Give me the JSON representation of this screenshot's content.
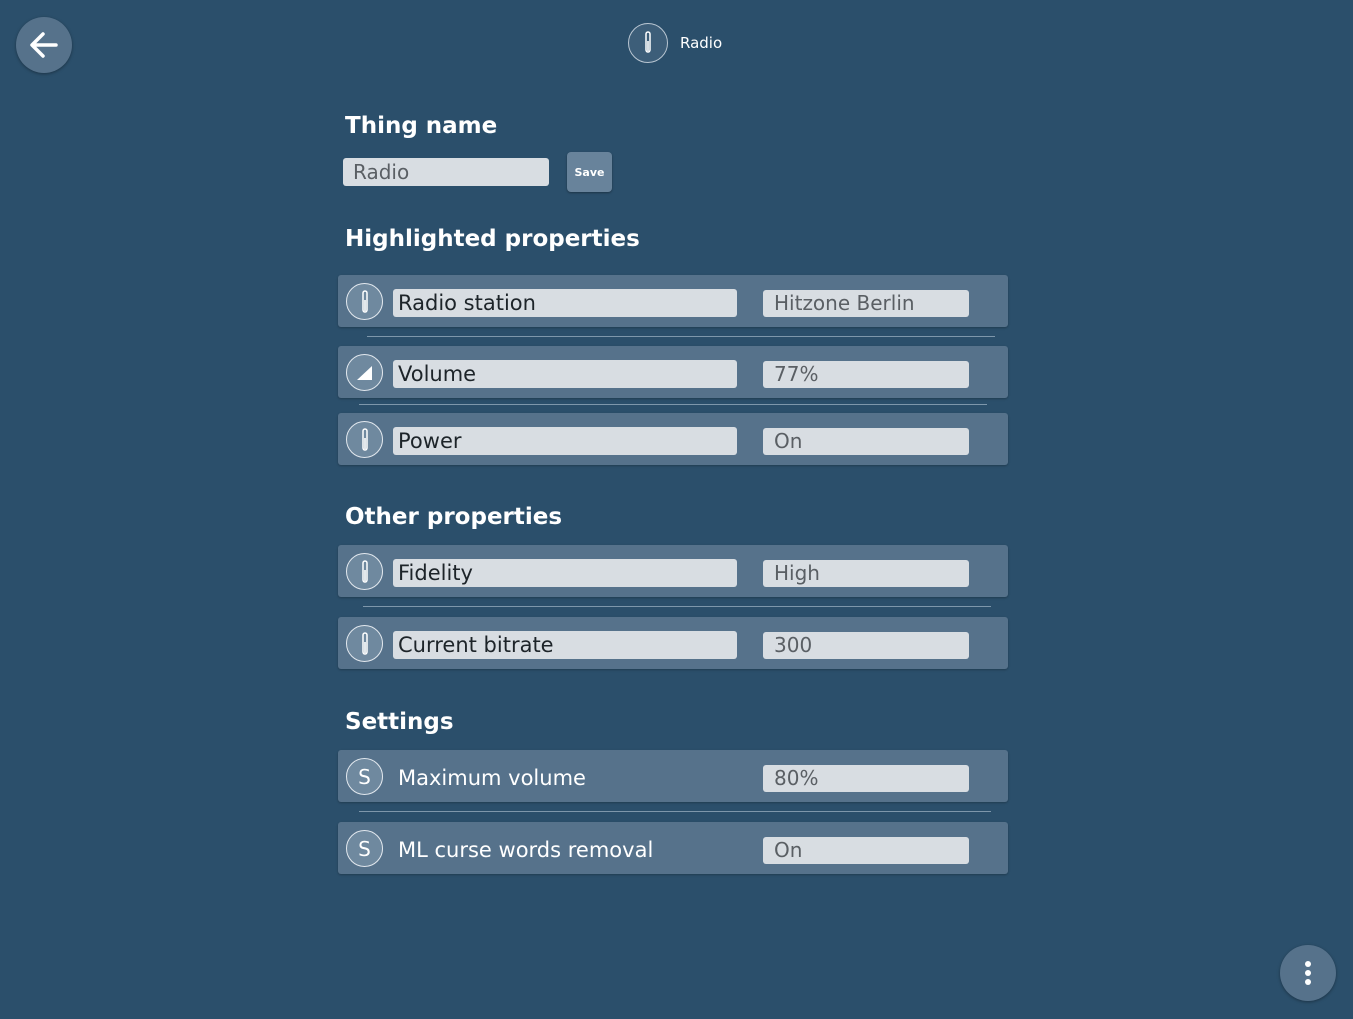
{
  "header": {
    "title": "Radio",
    "icon": "thermometer-icon"
  },
  "thing_name": {
    "heading": "Thing name",
    "value": "Radio",
    "save_label": "Save"
  },
  "highlighted": {
    "heading": "Highlighted properties",
    "items": [
      {
        "label": "Radio station",
        "value": "Hitzone Berlin",
        "icon": "thermometer-icon"
      },
      {
        "label": "Volume",
        "value": "77%",
        "icon": "volume-ramp-icon"
      },
      {
        "label": "Power",
        "value": "On",
        "icon": "thermometer-icon"
      }
    ]
  },
  "other": {
    "heading": "Other properties",
    "items": [
      {
        "label": "Fidelity",
        "value": "High",
        "icon": "thermometer-icon"
      },
      {
        "label": "Current bitrate",
        "value": "300",
        "icon": "thermometer-icon"
      }
    ]
  },
  "settings": {
    "heading": "Settings",
    "items": [
      {
        "label": "Maximum volume",
        "value": "80%",
        "icon_letter": "S"
      },
      {
        "label": "ML curse words removal",
        "value": "On",
        "icon_letter": "S"
      }
    ]
  },
  "colors": {
    "background": "#2b4f6b",
    "panel": "#56728b",
    "field": "#d8dde2"
  }
}
